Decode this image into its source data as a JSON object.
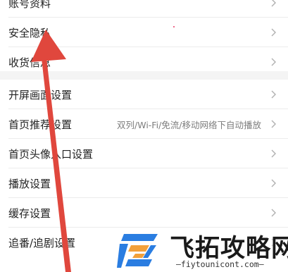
{
  "settings": {
    "group1": [
      {
        "label": "账号资料"
      },
      {
        "label": "安全隐私"
      },
      {
        "label": "收货信息"
      }
    ],
    "group2": [
      {
        "label": "开屏画面设置"
      },
      {
        "label": "首页推荐设置",
        "value": "双列/Wi-Fi/免流/移动网络下自动播放"
      },
      {
        "label": "首页头像入口设置"
      },
      {
        "label": "播放设置"
      },
      {
        "label": "缓存设置"
      },
      {
        "label": "追番/追剧设置"
      }
    ]
  },
  "watermark": {
    "title": "飞拓攻略网",
    "domain": "—fiytounicont.com—"
  },
  "colors": {
    "arrow": "#e0473d",
    "logo_blue": "#2a7de1",
    "logo_orange": "#f2a03a"
  }
}
